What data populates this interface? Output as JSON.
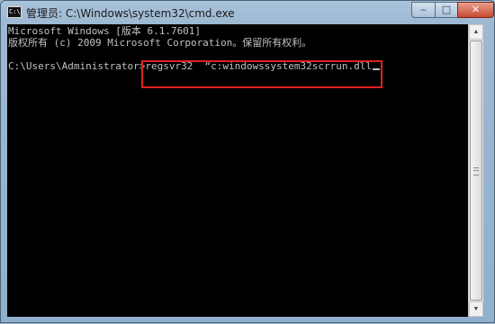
{
  "window": {
    "title": "管理员: C:\\Windows\\system32\\cmd.exe",
    "icon_text": "C:\\"
  },
  "controls": {
    "minimize_icon": "minimize-icon",
    "minimize_glyph": "‒",
    "maximize_icon": "maximize-icon",
    "maximize_glyph": "□",
    "close_icon": "close-icon",
    "close_glyph": "✕"
  },
  "console": {
    "lines": [
      "Microsoft Windows [版本 6.1.7601]",
      "版权所有 (c) 2009 Microsoft Corporation。保留所有权利。",
      "",
      "C:\\Users\\Administrator>"
    ],
    "command": "regsvr32  “c:windowssystem32scrrun.dll"
  },
  "annotation": {
    "highlight_color": "#e02020"
  },
  "scrollbar": {
    "up_icon": "scroll-up-icon",
    "up_glyph": "▲",
    "down_icon": "scroll-down-icon",
    "down_glyph": "▼"
  }
}
